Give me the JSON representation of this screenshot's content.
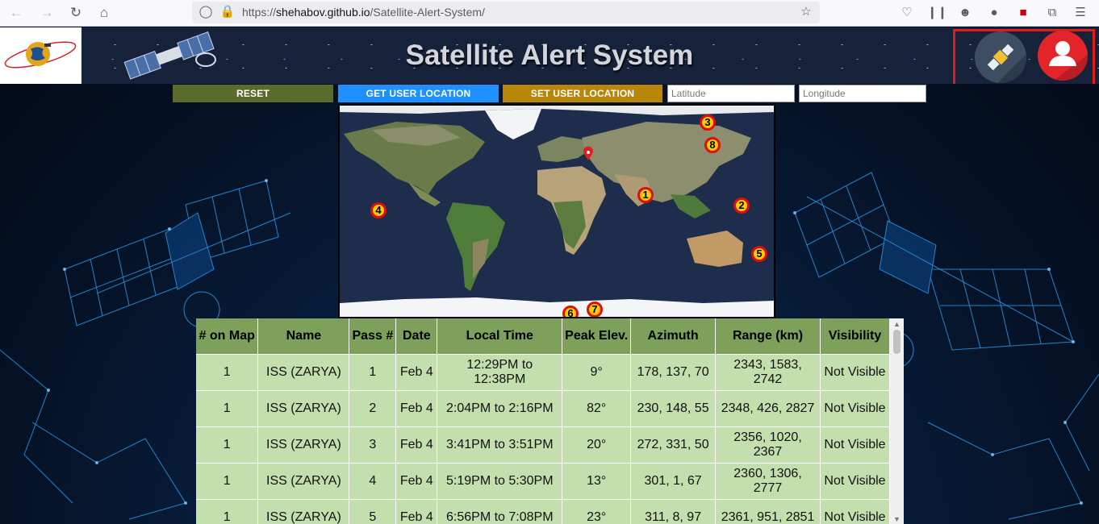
{
  "browser": {
    "url_prefix": "https://",
    "url_host": "shehabov.github.io",
    "url_path": "/Satellite-Alert-System/"
  },
  "header": {
    "title": "Satellite Alert System",
    "satellite_button_icon": "satellite-icon",
    "user_button_icon": "user-icon",
    "logo_icon": "globe-orbit-logo"
  },
  "controls": {
    "reset_label": "RESET",
    "get_location_label": "GET USER LOCATION",
    "set_location_label": "SET USER LOCATION",
    "latitude_placeholder": "Latitude",
    "longitude_placeholder": "Longitude"
  },
  "colors": {
    "reset": "#5a6b2d",
    "get_location": "#1e90ff",
    "set_location": "#b8860b",
    "table_header": "#7da05b",
    "table_cell": "#c4dfae",
    "marker_fill": "#ffcc00",
    "marker_border": "#e10c0c",
    "highlight_frame": "#e31b1b"
  },
  "map": {
    "markers": [
      {
        "label": "1"
      },
      {
        "label": "2"
      },
      {
        "label": "3"
      },
      {
        "label": "4"
      },
      {
        "label": "5"
      },
      {
        "label": "6"
      },
      {
        "label": "7"
      },
      {
        "label": "8"
      }
    ]
  },
  "table": {
    "headers": [
      "# on Map",
      "Name",
      "Pass #",
      "Date",
      "Local Time",
      "Peak Elev.",
      "Azimuth",
      "Range (km)",
      "Visibility"
    ],
    "rows": [
      [
        "1",
        "ISS (ZARYA)",
        "1",
        "Feb 4",
        "12:29PM to 12:38PM",
        "9°",
        "178, 137, 70",
        "2343, 1583, 2742",
        "Not Visible"
      ],
      [
        "1",
        "ISS (ZARYA)",
        "2",
        "Feb 4",
        "2:04PM to 2:16PM",
        "82°",
        "230, 148, 55",
        "2348, 426, 2827",
        "Not Visible"
      ],
      [
        "1",
        "ISS (ZARYA)",
        "3",
        "Feb 4",
        "3:41PM to 3:51PM",
        "20°",
        "272, 331, 50",
        "2356, 1020, 2367",
        "Not Visible"
      ],
      [
        "1",
        "ISS (ZARYA)",
        "4",
        "Feb 4",
        "5:19PM to 5:30PM",
        "13°",
        "301, 1, 67",
        "2360, 1306, 2777",
        "Not Visible"
      ],
      [
        "1",
        "ISS (ZARYA)",
        "5",
        "Feb 4",
        "6:56PM to 7:08PM",
        "23°",
        "311, 8, 97",
        "2361, 951, 2851",
        "Not Visible"
      ]
    ]
  }
}
